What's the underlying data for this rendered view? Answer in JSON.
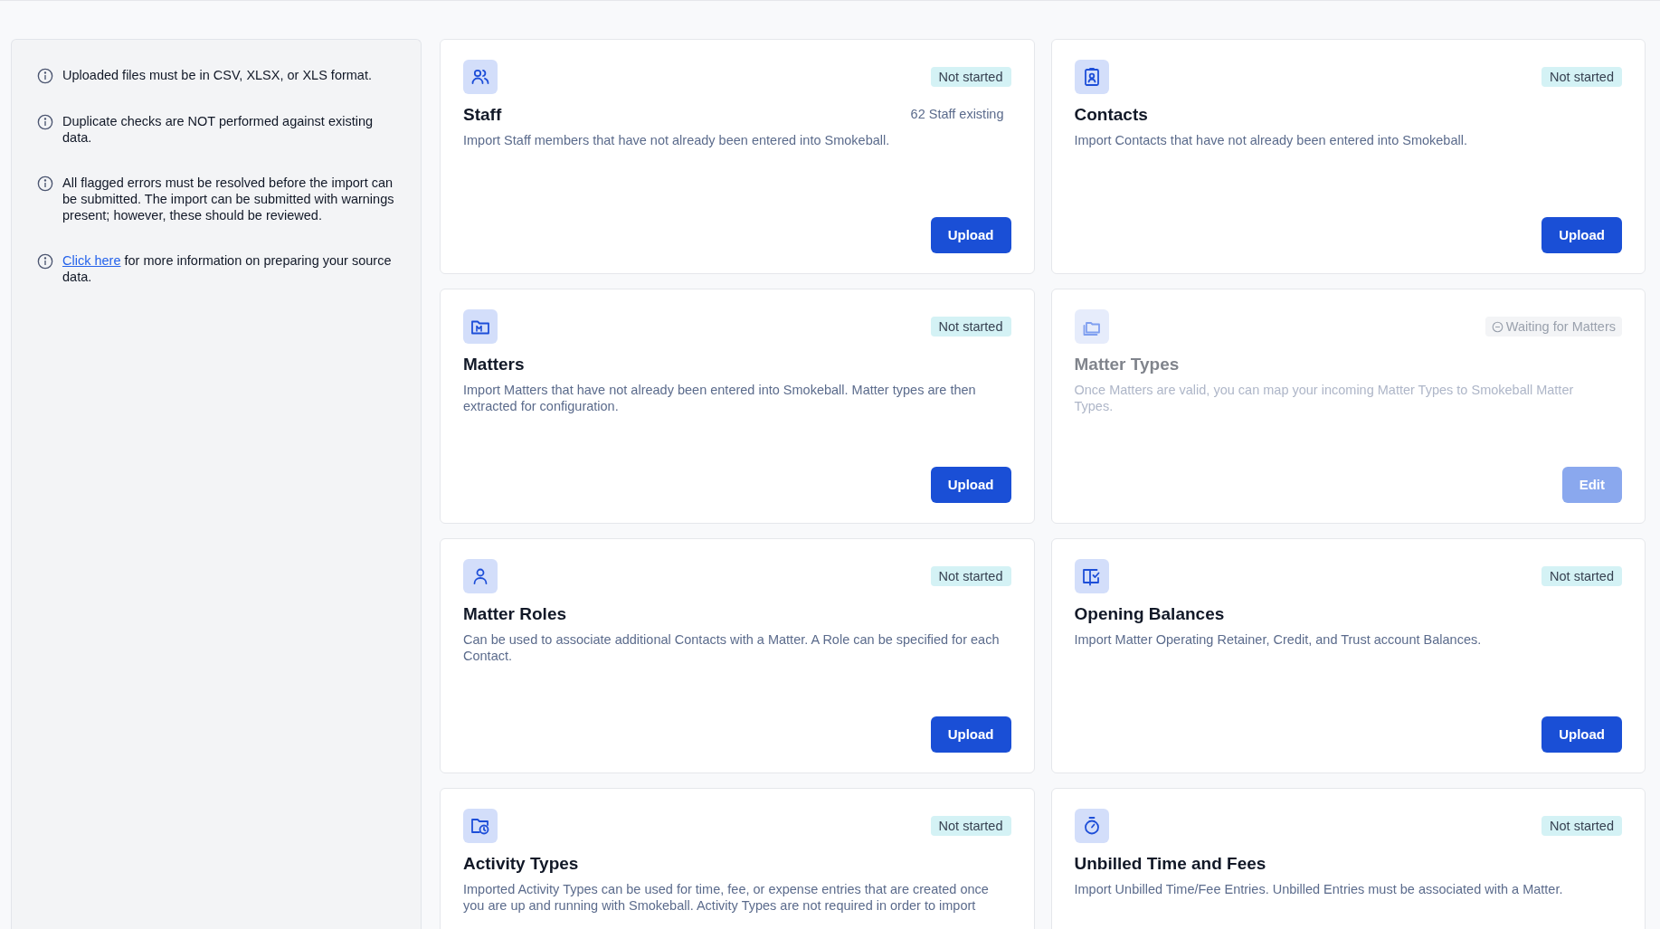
{
  "notes": [
    {
      "text": "Uploaded files must be in CSV, XLSX, or XLS format."
    },
    {
      "text": "Duplicate checks are NOT performed against existing data."
    },
    {
      "text": "All flagged errors must be resolved before the import can be submitted. The import can be submitted with warnings present; however, these should be reviewed."
    },
    {
      "link": "Click here",
      "text": "for more information on preparing your source data."
    }
  ],
  "cards": [
    {
      "title": "Staff",
      "status": {
        "kind": "not_started",
        "label": "Not started"
      },
      "count": "62 Staff existing",
      "description": "Import Staff members that have not already been entered into Smokeball.",
      "button": "Upload",
      "disabled": false
    },
    {
      "title": "Contacts",
      "status": {
        "kind": "not_started",
        "label": "Not started"
      },
      "description": "Import Contacts that have not already been entered into Smokeball.",
      "button": "Upload",
      "disabled": false
    },
    {
      "title": "Matters",
      "status": {
        "kind": "not_started",
        "label": "Not started"
      },
      "description": "Import Matters that have not already been entered into Smokeball. Matter types are then extracted for configuration.",
      "button": "Upload",
      "disabled": false
    },
    {
      "title": "Matter Types",
      "status": {
        "kind": "waiting",
        "label": "Waiting for Matters"
      },
      "description": "Once Matters are valid, you can map your incoming Matter Types to Smokeball Matter Types.",
      "button": "Edit",
      "disabled": true
    },
    {
      "title": "Matter Roles",
      "status": {
        "kind": "not_started",
        "label": "Not started"
      },
      "description": "Can be used to associate additional Contacts with a Matter. A Role can be specified for each Contact.",
      "button": "Upload",
      "disabled": false
    },
    {
      "title": "Opening Balances",
      "status": {
        "kind": "not_started",
        "label": "Not started"
      },
      "description": "Import Matter Operating Retainer, Credit, and Trust account Balances.",
      "button": "Upload",
      "disabled": false
    },
    {
      "title": "Activity Types",
      "status": {
        "kind": "not_started",
        "label": "Not started"
      },
      "description": "Imported Activity Types can be used for time, fee, or expense entries that are created once you are up and running with Smokeball. Activity Types are not required in order to import",
      "disabled": false
    },
    {
      "title": "Unbilled Time and Fees",
      "status": {
        "kind": "not_started",
        "label": "Not started"
      },
      "description": "Import Unbilled Time/Fee Entries. Unbilled Entries must be associated with a Matter.",
      "disabled": false
    }
  ]
}
